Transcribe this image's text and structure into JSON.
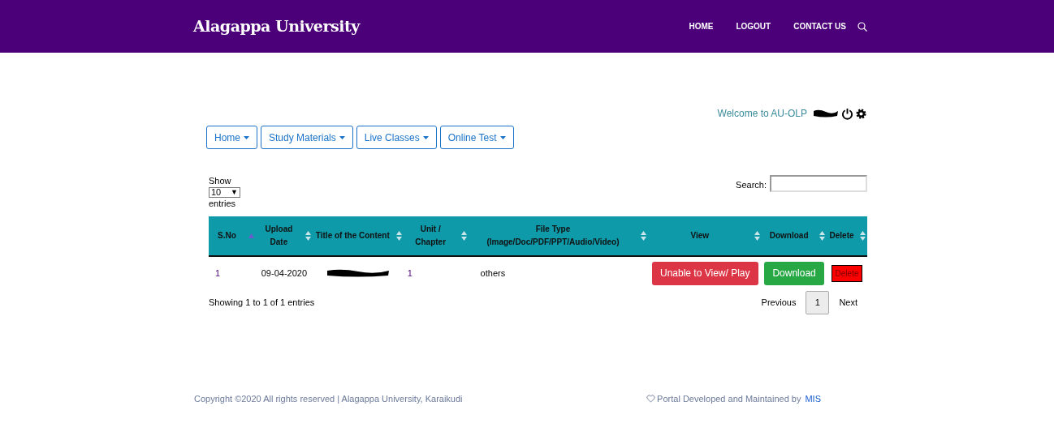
{
  "header": {
    "brand": "Alagappa University",
    "nav": [
      "HOME",
      "LOGOUT",
      "CONTACT US"
    ]
  },
  "welcome": "Welcome to AU-OLP",
  "menus": [
    "Home",
    "Study Materials",
    "Live Classes",
    "Online Test"
  ],
  "length": {
    "show": "Show",
    "value": "10",
    "arrow": "▼",
    "entries": "entries"
  },
  "search": {
    "label": "Search:"
  },
  "table": {
    "columns": [
      {
        "label": "S.No",
        "sorted": true
      },
      {
        "label": "Upload Date",
        "sorted": false
      },
      {
        "label": "Title of the Content",
        "sorted": false
      },
      {
        "label": "Unit / Chapter",
        "sorted": false
      },
      {
        "label": "File Type (Image/Doc/PDF/PPT/Audio/Video)",
        "sorted": false
      },
      {
        "label": "View",
        "sorted": false
      },
      {
        "label": "Download",
        "sorted": false
      },
      {
        "label": "Delete",
        "sorted": false
      }
    ],
    "rows": [
      {
        "sno": "1",
        "date": "09-04-2020",
        "title_redacted": true,
        "unit": "1",
        "type": "others",
        "view": "Unable to View/ Play",
        "download": "Download",
        "delete": "Delete"
      }
    ]
  },
  "info": "Showing 1 to 1 of 1 entries",
  "pagination": {
    "previous": "Previous",
    "pages": [
      {
        "label": "1",
        "selected": true
      }
    ],
    "next": "Next"
  },
  "footer": {
    "copyright": "Copyright ©2020 All rights reserved | Alagappa University, Karaikudi",
    "credit": "Portal Developed and Maintained by",
    "link": "MIS"
  }
}
